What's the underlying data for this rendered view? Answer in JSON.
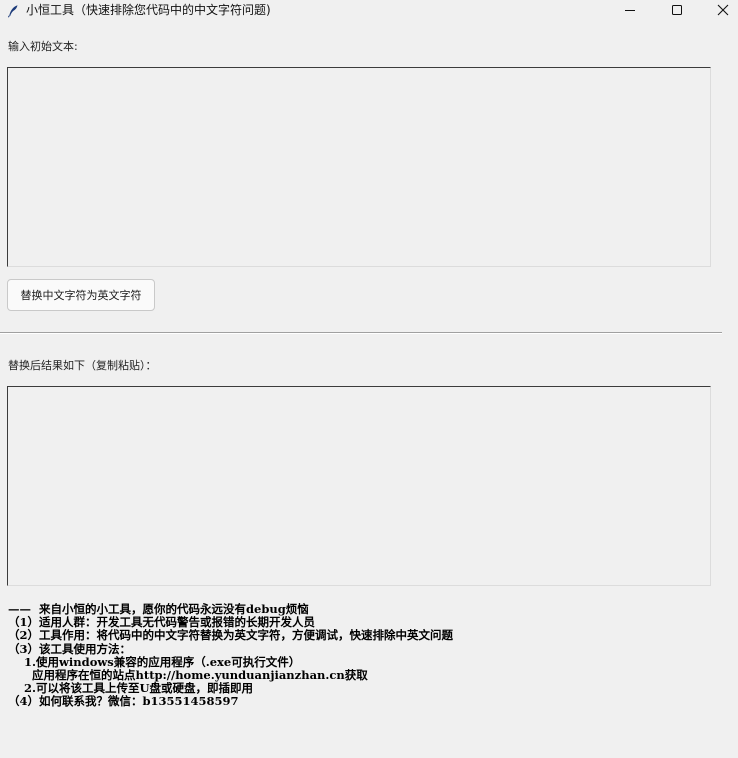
{
  "window": {
    "title": "小恒工具（快速排除您代码中的中文字符问题)",
    "icons": {
      "app": "feather-icon",
      "minimize": "minimize-icon",
      "maximize": "maximize-icon",
      "close": "close-icon"
    }
  },
  "input_section": {
    "label": "输入初始文本:",
    "value": ""
  },
  "replace_button": {
    "label": "替换中文字符为英文字符"
  },
  "output_section": {
    "label": "替换后结果如下（复制粘贴）：",
    "value": ""
  },
  "info": {
    "lines": [
      "——  来自小恒的小工具，愿你的代码永远没有debug烦恼",
      "（1）适用人群：开发工具无代码警告或报错的长期开发人员",
      "（2）工具作用：将代码中的中文字符替换为英文字符，方便调试，快速排除中英文问题",
      "（3）该工具使用方法：",
      "    1.使用windows兼容的应用程序（.exe可执行文件）",
      "      应用程序在恒的站点http://home.yunduanjianzhan.cn获取",
      "    2.可以将该工具上传至U盘或硬盘，即插即用",
      "（4）如何联系我？微信：b13551458597"
    ]
  }
}
